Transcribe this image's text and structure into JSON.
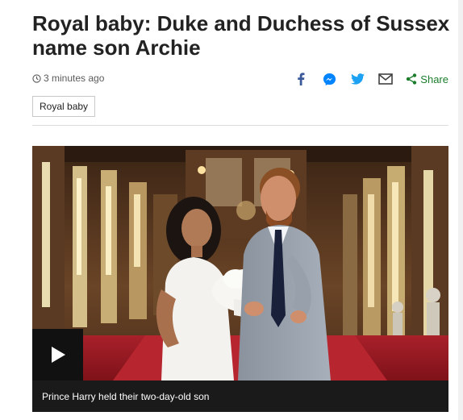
{
  "article": {
    "headline": "Royal baby: Duke and Duchess of Sussex name son Archie",
    "timestamp": "3 minutes ago",
    "tag": "Royal baby"
  },
  "share": {
    "label": "Share",
    "icons": [
      "facebook-icon",
      "messenger-icon",
      "twitter-icon",
      "email-icon",
      "share-icon"
    ],
    "colors": {
      "facebook": "#3b5998",
      "messenger": "#0084ff",
      "twitter": "#1da1f2",
      "email": "#404040",
      "share": "#1b7d2b"
    }
  },
  "media": {
    "caption": "Prince Harry held their two-day-old son",
    "play_icon": "play-icon"
  }
}
